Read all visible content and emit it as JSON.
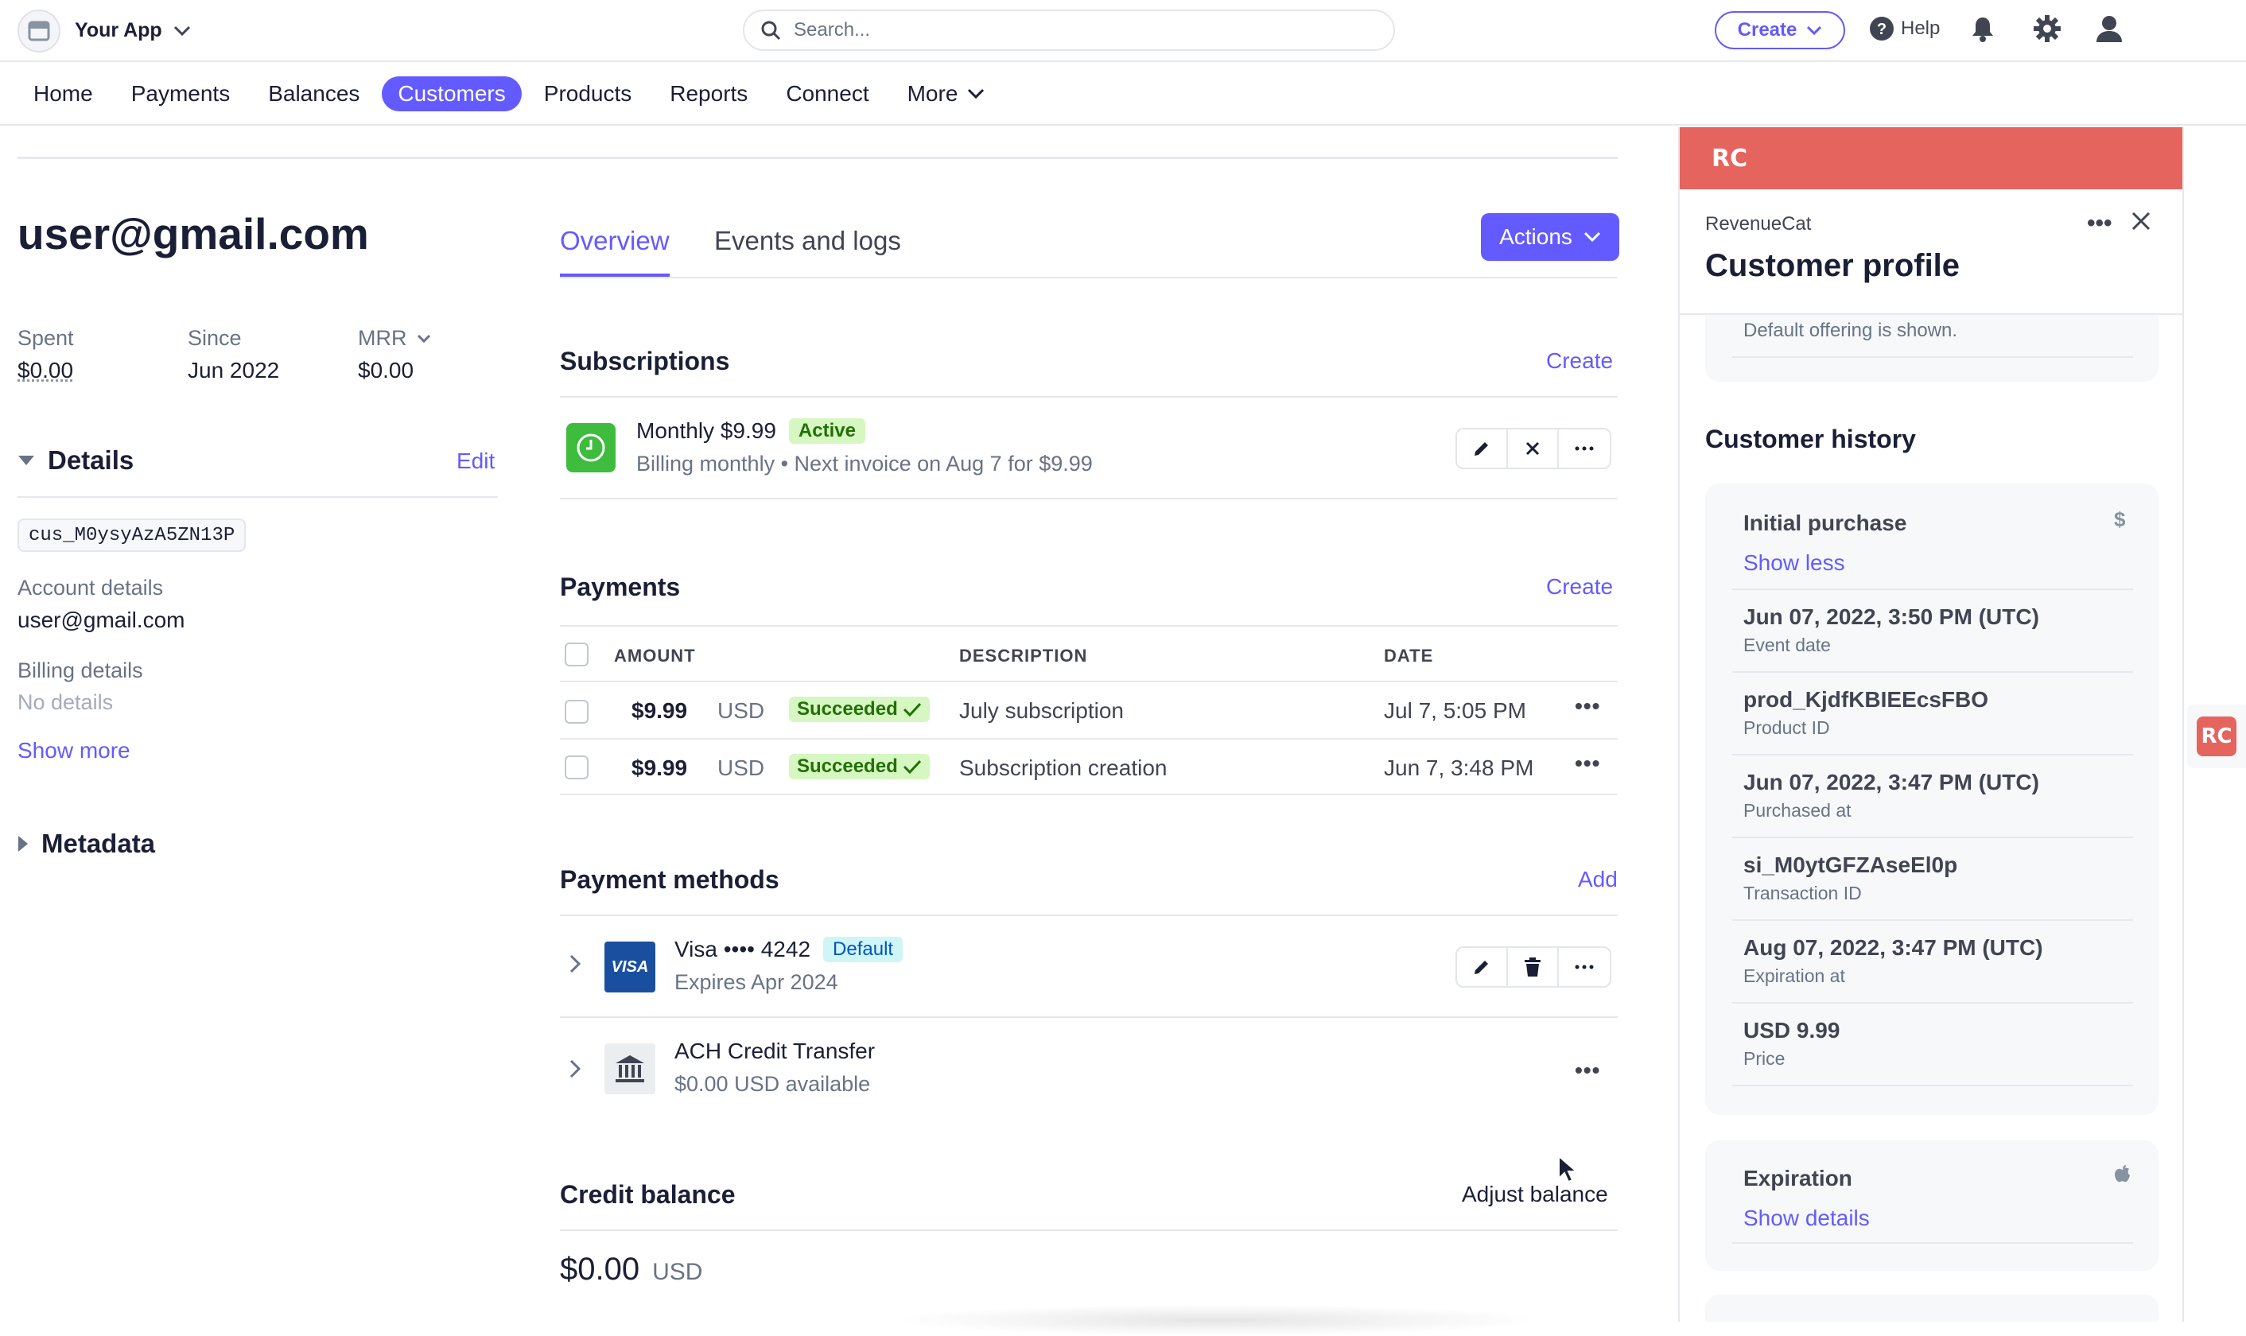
{
  "topbar": {
    "app_name": "Your App",
    "search_placeholder": "Search...",
    "create_label": "Create",
    "help_label": "Help"
  },
  "nav": {
    "items": [
      {
        "label": "Home"
      },
      {
        "label": "Payments"
      },
      {
        "label": "Balances"
      },
      {
        "label": "Customers",
        "active": true
      },
      {
        "label": "Products"
      },
      {
        "label": "Reports"
      },
      {
        "label": "Connect"
      },
      {
        "label": "More"
      }
    ]
  },
  "customer": {
    "email": "user@gmail.com",
    "stats": [
      {
        "label": "Spent",
        "value": "$0.00"
      },
      {
        "label": "Since",
        "value": "Jun 2022"
      },
      {
        "label": "MRR",
        "value": "$0.00"
      }
    ],
    "details_heading": "Details",
    "edit_label": "Edit",
    "customer_id": "cus_M0ysyAzA5ZN13P",
    "account_details_label": "Account details",
    "account_details_value": "user@gmail.com",
    "billing_details_label": "Billing details",
    "billing_details_value": "No details",
    "show_more": "Show more",
    "metadata_heading": "Metadata"
  },
  "tabs": [
    {
      "label": "Overview",
      "active": true
    },
    {
      "label": "Events and logs"
    }
  ],
  "actions_label": "Actions",
  "subscriptions": {
    "heading": "Subscriptions",
    "create_label": "Create",
    "item": {
      "name": "Monthly $9.99",
      "status": "Active",
      "detail": "Billing monthly • Next invoice on Aug 7 for $9.99"
    }
  },
  "payments": {
    "heading": "Payments",
    "create_label": "Create",
    "columns": [
      "AMOUNT",
      "DESCRIPTION",
      "DATE"
    ],
    "rows": [
      {
        "amount": "$9.99",
        "currency": "USD",
        "status": "Succeeded",
        "description": "July subscription",
        "date": "Jul 7, 5:05 PM"
      },
      {
        "amount": "$9.99",
        "currency": "USD",
        "status": "Succeeded",
        "description": "Subscription creation",
        "date": "Jun 7, 3:48 PM"
      }
    ]
  },
  "payment_methods": {
    "heading": "Payment methods",
    "add_label": "Add",
    "items": [
      {
        "brand": "VISA",
        "title": "Visa •••• 4242",
        "badge": "Default",
        "subtitle": "Expires Apr 2024"
      },
      {
        "title": "ACH Credit Transfer",
        "subtitle": "$0.00 USD available"
      }
    ]
  },
  "credit_balance": {
    "heading": "Credit balance",
    "adjust_label": "Adjust balance",
    "amount": "$0.00",
    "currency": "USD"
  },
  "revenuecat_panel": {
    "logo": "RC",
    "app": "RevenueCat",
    "title": "Customer profile",
    "default_offering": "Default offering is shown.",
    "history_heading": "Customer history",
    "initial_purchase": {
      "title": "Initial purchase",
      "symbol": "$",
      "toggle": "Show less",
      "fields": [
        {
          "value": "Jun 07, 2022, 3:50 PM (UTC)",
          "label": "Event date"
        },
        {
          "value": "prod_KjdfKBIEEcsFBO",
          "label": "Product ID"
        },
        {
          "value": "Jun 07, 2022, 3:47 PM (UTC)",
          "label": "Purchased at"
        },
        {
          "value": "si_M0ytGFZAseEl0p",
          "label": "Transaction ID"
        },
        {
          "value": "Aug 07, 2022, 3:47 PM (UTC)",
          "label": "Expiration at"
        },
        {
          "value": "USD 9.99",
          "label": "Price"
        }
      ]
    },
    "expiration": {
      "title": "Expiration",
      "toggle": "Show details"
    }
  },
  "colors": {
    "accent": "#635bff",
    "revenuecat": "#e5645d",
    "success_bg": "#d7f7c2",
    "success_fg": "#217005"
  }
}
